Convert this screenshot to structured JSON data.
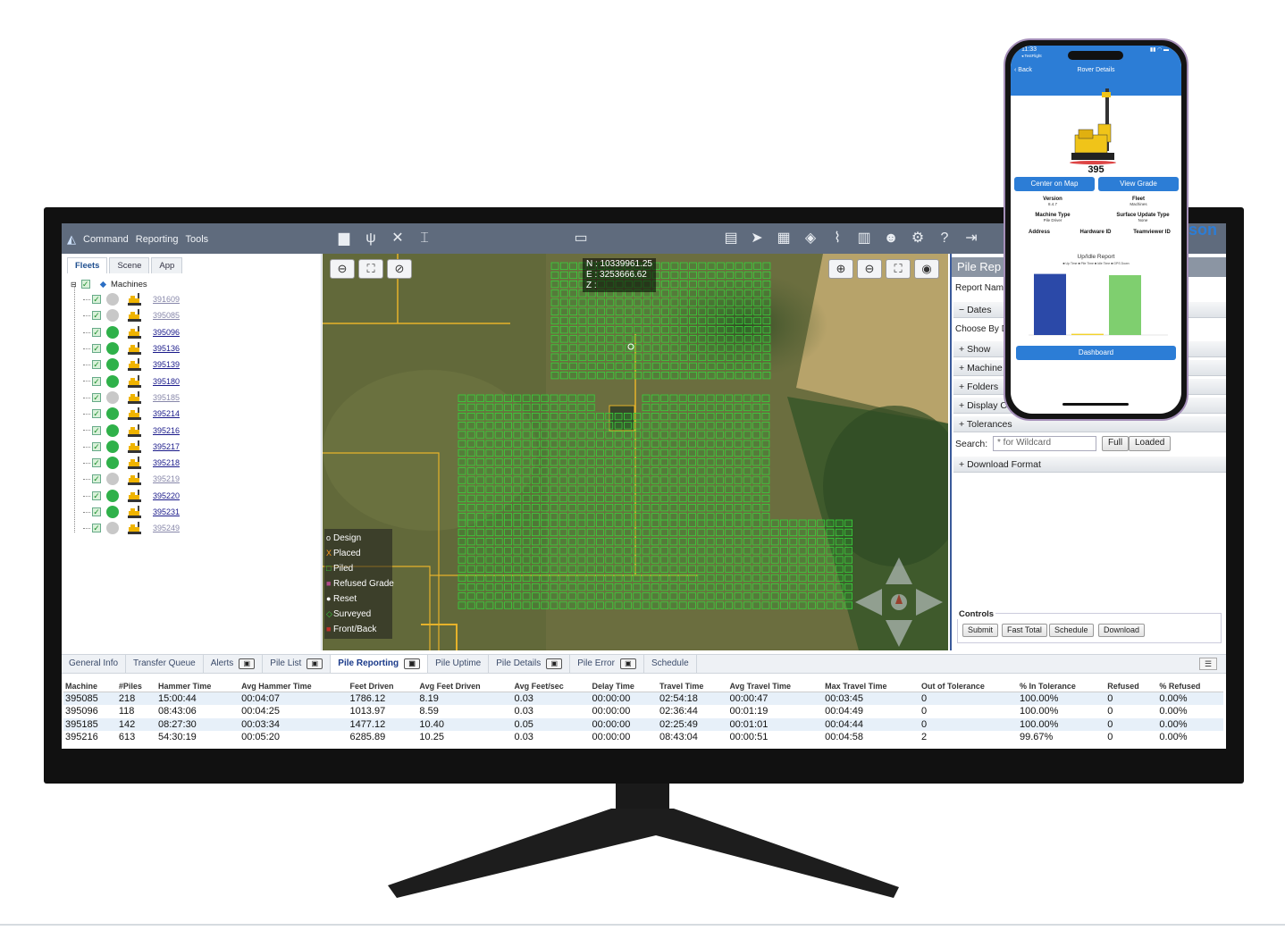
{
  "app": {
    "menu": [
      "Command",
      "Reporting",
      "Tools"
    ]
  },
  "left_panel": {
    "tabs": [
      "Fleets",
      "Scene",
      "App"
    ],
    "root_label": "Machines",
    "machines": [
      {
        "id": "391609",
        "status": "gray"
      },
      {
        "id": "395085",
        "status": "gray"
      },
      {
        "id": "395096",
        "status": "green"
      },
      {
        "id": "395136",
        "status": "green"
      },
      {
        "id": "395139",
        "status": "green"
      },
      {
        "id": "395180",
        "status": "green"
      },
      {
        "id": "395185",
        "status": "gray"
      },
      {
        "id": "395214",
        "status": "green"
      },
      {
        "id": "395216",
        "status": "green"
      },
      {
        "id": "395217",
        "status": "green"
      },
      {
        "id": "395218",
        "status": "green"
      },
      {
        "id": "395219",
        "status": "gray"
      },
      {
        "id": "395220",
        "status": "green"
      },
      {
        "id": "395231",
        "status": "green"
      },
      {
        "id": "395249",
        "status": "gray"
      }
    ]
  },
  "map": {
    "coords": {
      "n": "N : 10339961.25",
      "e": "E : 3253666.62",
      "z": "Z :"
    },
    "legend": [
      {
        "symbol": "o",
        "label": "Design",
        "color": "#ffffff"
      },
      {
        "symbol": "X",
        "label": "Placed",
        "color": "#ff9a1a"
      },
      {
        "symbol": "□",
        "label": "Piled",
        "color": "#39d33c"
      },
      {
        "symbol": "■",
        "label": "Refused Grade",
        "color": "#b04a8a"
      },
      {
        "symbol": "●",
        "label": "Reset",
        "color": "#ffffff"
      },
      {
        "symbol": "◇",
        "label": "Surveyed",
        "color": "#39d33c"
      },
      {
        "symbol": "■",
        "label": "Front/Back",
        "color": "#c0302a"
      }
    ]
  },
  "report": {
    "title": "Pile Rep",
    "report_name_label": "Report Name",
    "dates_label": "Dates",
    "choose_by_label": "Choose By D",
    "sections": [
      "Show",
      "Machine",
      "Folders",
      "Display C",
      "Tolerances"
    ],
    "search_label": "Search:",
    "search_placeholder": "* for Wildcard",
    "full_btn": "Full",
    "loaded_btn": "Loaded",
    "download_format_label": "Download Format",
    "controls_label": "Controls",
    "controls": [
      "Submit",
      "Fast Total",
      "Schedule",
      "Download"
    ]
  },
  "bottom_tabs": [
    {
      "label": "General Info",
      "icon": false,
      "active": false
    },
    {
      "label": "Transfer Queue",
      "icon": false,
      "active": false
    },
    {
      "label": "Alerts",
      "icon": true,
      "active": false
    },
    {
      "label": "Pile List",
      "icon": true,
      "active": false
    },
    {
      "label": "Pile Reporting",
      "icon": true,
      "active": true
    },
    {
      "label": "Pile Uptime",
      "icon": false,
      "active": false
    },
    {
      "label": "Pile Details",
      "icon": true,
      "active": false
    },
    {
      "label": "Pile Error",
      "icon": true,
      "active": false
    },
    {
      "label": "Schedule",
      "icon": false,
      "active": false
    }
  ],
  "table": {
    "headers": [
      "Machine",
      "#Piles",
      "Hammer Time",
      "Avg Hammer Time",
      "Feet Driven",
      "Avg Feet Driven",
      "Avg Feet/sec",
      "Delay Time",
      "Travel Time",
      "Avg Travel Time",
      "Max Travel Time",
      "Out of Tolerance",
      "% In Tolerance",
      "Refused",
      "% Refused"
    ],
    "rows": [
      [
        "395085",
        "218",
        "15:00:44",
        "00:04:07",
        "1786.12",
        "8.19",
        "0.03",
        "00:00:00",
        "02:54:18",
        "00:00:47",
        "00:03:45",
        "0",
        "100.00%",
        "0",
        "0.00%"
      ],
      [
        "395096",
        "118",
        "08:43:06",
        "00:04:25",
        "1013.97",
        "8.59",
        "0.03",
        "00:00:00",
        "02:36:44",
        "00:01:19",
        "00:04:49",
        "0",
        "100.00%",
        "0",
        "0.00%"
      ],
      [
        "395185",
        "142",
        "08:27:30",
        "00:03:34",
        "1477.12",
        "10.40",
        "0.05",
        "00:00:00",
        "02:25:49",
        "00:01:01",
        "00:04:44",
        "0",
        "100.00%",
        "0",
        "0.00%"
      ],
      [
        "395216",
        "613",
        "54:30:19",
        "00:05:20",
        "6285.89",
        "10.25",
        "0.03",
        "00:00:00",
        "08:43:04",
        "00:00:51",
        "00:04:58",
        "2",
        "99.67%",
        "0",
        "0.00%"
      ]
    ]
  },
  "phone": {
    "time": "11:33",
    "sub": "◂ TestFlight",
    "back": "Back",
    "title": "Rover Details",
    "machine_number": "395",
    "center_btn": "Center on Map",
    "grade_btn": "View Grade",
    "kv": [
      {
        "k": "Version",
        "v": "8.4.7"
      },
      {
        "k": "Fleet",
        "v": "Machines"
      },
      {
        "k": "Machine Type",
        "v": "Pile Driver"
      },
      {
        "k": "Surface Update Type",
        "v": "None"
      },
      {
        "k": "Address",
        "v": ""
      },
      {
        "k": "Hardware ID",
        "v": ""
      },
      {
        "k": "Teamviewer ID",
        "v": ""
      }
    ],
    "report_title": "Up/Idle Report",
    "report_legend": "■ Up Time  ■ Pile Time  ■ Idle Time  ■ GPS Down",
    "chart_values": [
      {
        "value": 0.95,
        "color": "#2b49a8"
      },
      {
        "value": 0.02,
        "color": "#f2d22b"
      },
      {
        "value": 0.93,
        "color": "#7fcf6f"
      }
    ],
    "dashboard_btn": "Dashboard"
  },
  "logo_fragment": "son"
}
